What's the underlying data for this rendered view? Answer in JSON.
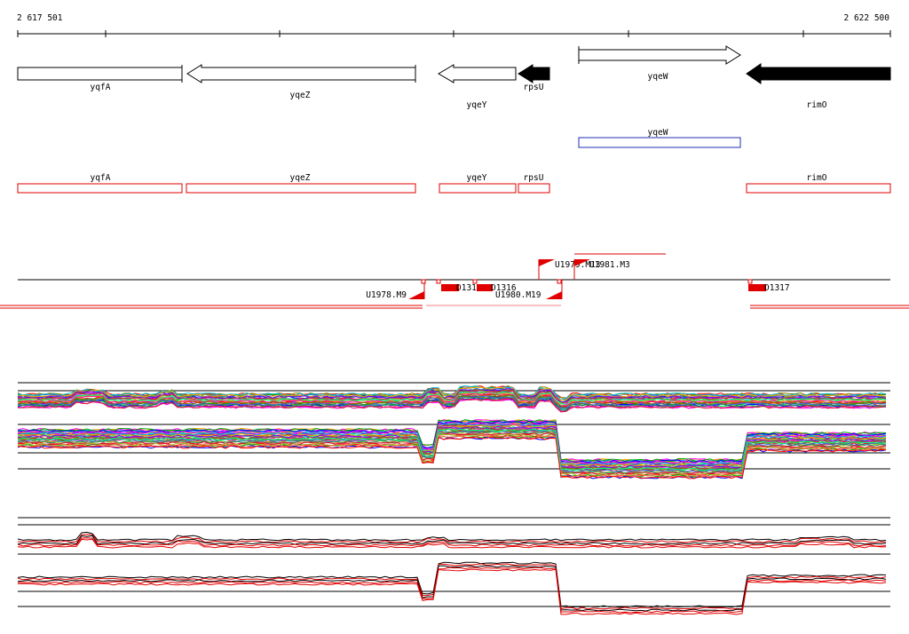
{
  "coords": {
    "start_label": "2 617 501",
    "end_label": "2 622 500"
  },
  "genes": [
    {
      "name": "yqfA",
      "dir": "right",
      "filled": false,
      "label_pos": "below"
    },
    {
      "name": "yqeZ",
      "dir": "left",
      "filled": false,
      "label_pos": "below"
    },
    {
      "name": "yqeY",
      "dir": "left",
      "filled": false,
      "label_pos": "below"
    },
    {
      "name": "rpsU",
      "dir": "left",
      "filled": true,
      "label_pos": "below"
    },
    {
      "name": "yqeW",
      "dir": "right",
      "filled": false,
      "label_pos": "below"
    },
    {
      "name": "rimO",
      "dir": "left",
      "filled": true,
      "label_pos": "below"
    }
  ],
  "blue_track": {
    "name": "yqeW"
  },
  "red_track": [
    "yqfA",
    "yqeZ",
    "yqeY",
    "rpsU",
    "rimO"
  ],
  "features": [
    {
      "label": "U1978.M9"
    },
    {
      "label": "D1315"
    },
    {
      "label": "D1316"
    },
    {
      "label": "U1980.M19"
    },
    {
      "label": "U1979.M13"
    },
    {
      "label": "U1981.M3"
    },
    {
      "label": "D1317"
    }
  ],
  "colors": {
    "gene_stroke": "#000000",
    "filled_gene": "#000000",
    "blue": "#1f2fb0",
    "red": "#e00000"
  }
}
